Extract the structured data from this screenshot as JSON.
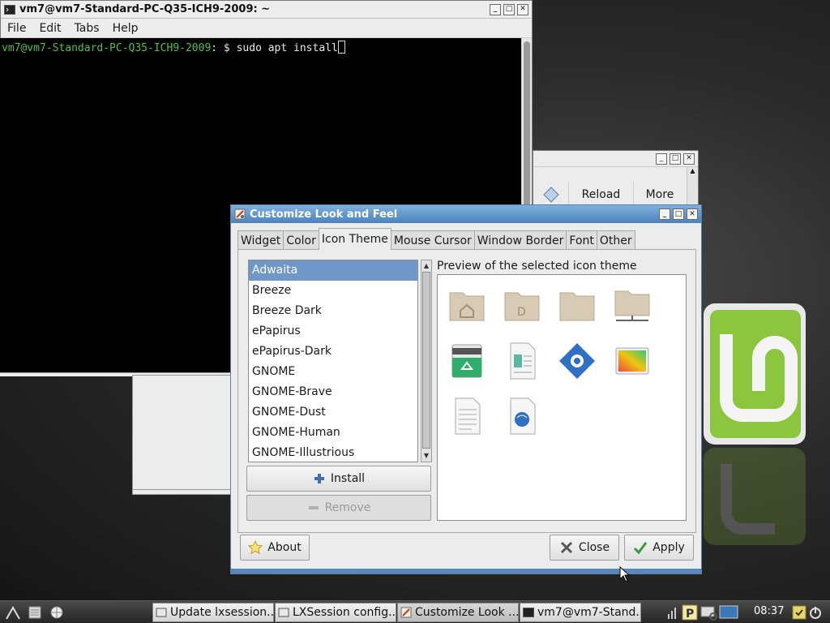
{
  "terminal": {
    "title": "vm7@vm7-Standard-PC-Q35-ICH9-2009: ~",
    "menu": [
      "File",
      "Edit",
      "Tabs",
      "Help"
    ],
    "prompt_user": "vm7@vm7-Standard-PC-Q35-ICH9-2009",
    "prompt_rest": ": $ sudo apt install"
  },
  "background_window": {
    "reload_label": "Reload",
    "more_label": "More"
  },
  "dialog": {
    "title": "Customize Look and Feel",
    "tabs": [
      "Widget",
      "Color",
      "Icon Theme",
      "Mouse Cursor",
      "Window Border",
      "Font",
      "Other"
    ],
    "active_tab": "Icon Theme",
    "themes": [
      "Adwaita",
      "Breeze",
      "Breeze Dark",
      "ePapirus",
      "ePapirus-Dark",
      "GNOME",
      "GNOME-Brave",
      "GNOME-Dust",
      "GNOME-Human",
      "GNOME-Illustrious"
    ],
    "selected_theme": "Adwaita",
    "install_label": "Install",
    "remove_label": "Remove",
    "preview_label": "Preview of the selected icon theme",
    "preview_icons": [
      "home-folder-icon",
      "documents-folder-icon",
      "folder-icon",
      "network-folder-icon",
      "trash-icon",
      "document-icon",
      "settings-gear-icon",
      "image-icon",
      "text-file-icon",
      "html-file-icon"
    ],
    "about_label": "About",
    "close_label": "Close",
    "apply_label": "Apply"
  },
  "taskbar": {
    "tasks": [
      "Update lxsession...",
      "LXSession config...",
      "Customize Look ...",
      "vm7@vm7-Stand..."
    ],
    "clock": "08:37"
  },
  "colors": {
    "accent": "#4a83bd",
    "selection": "#6f97c8",
    "terminal_prompt": "#4ec23b",
    "mint_green": "#8cc63f"
  }
}
